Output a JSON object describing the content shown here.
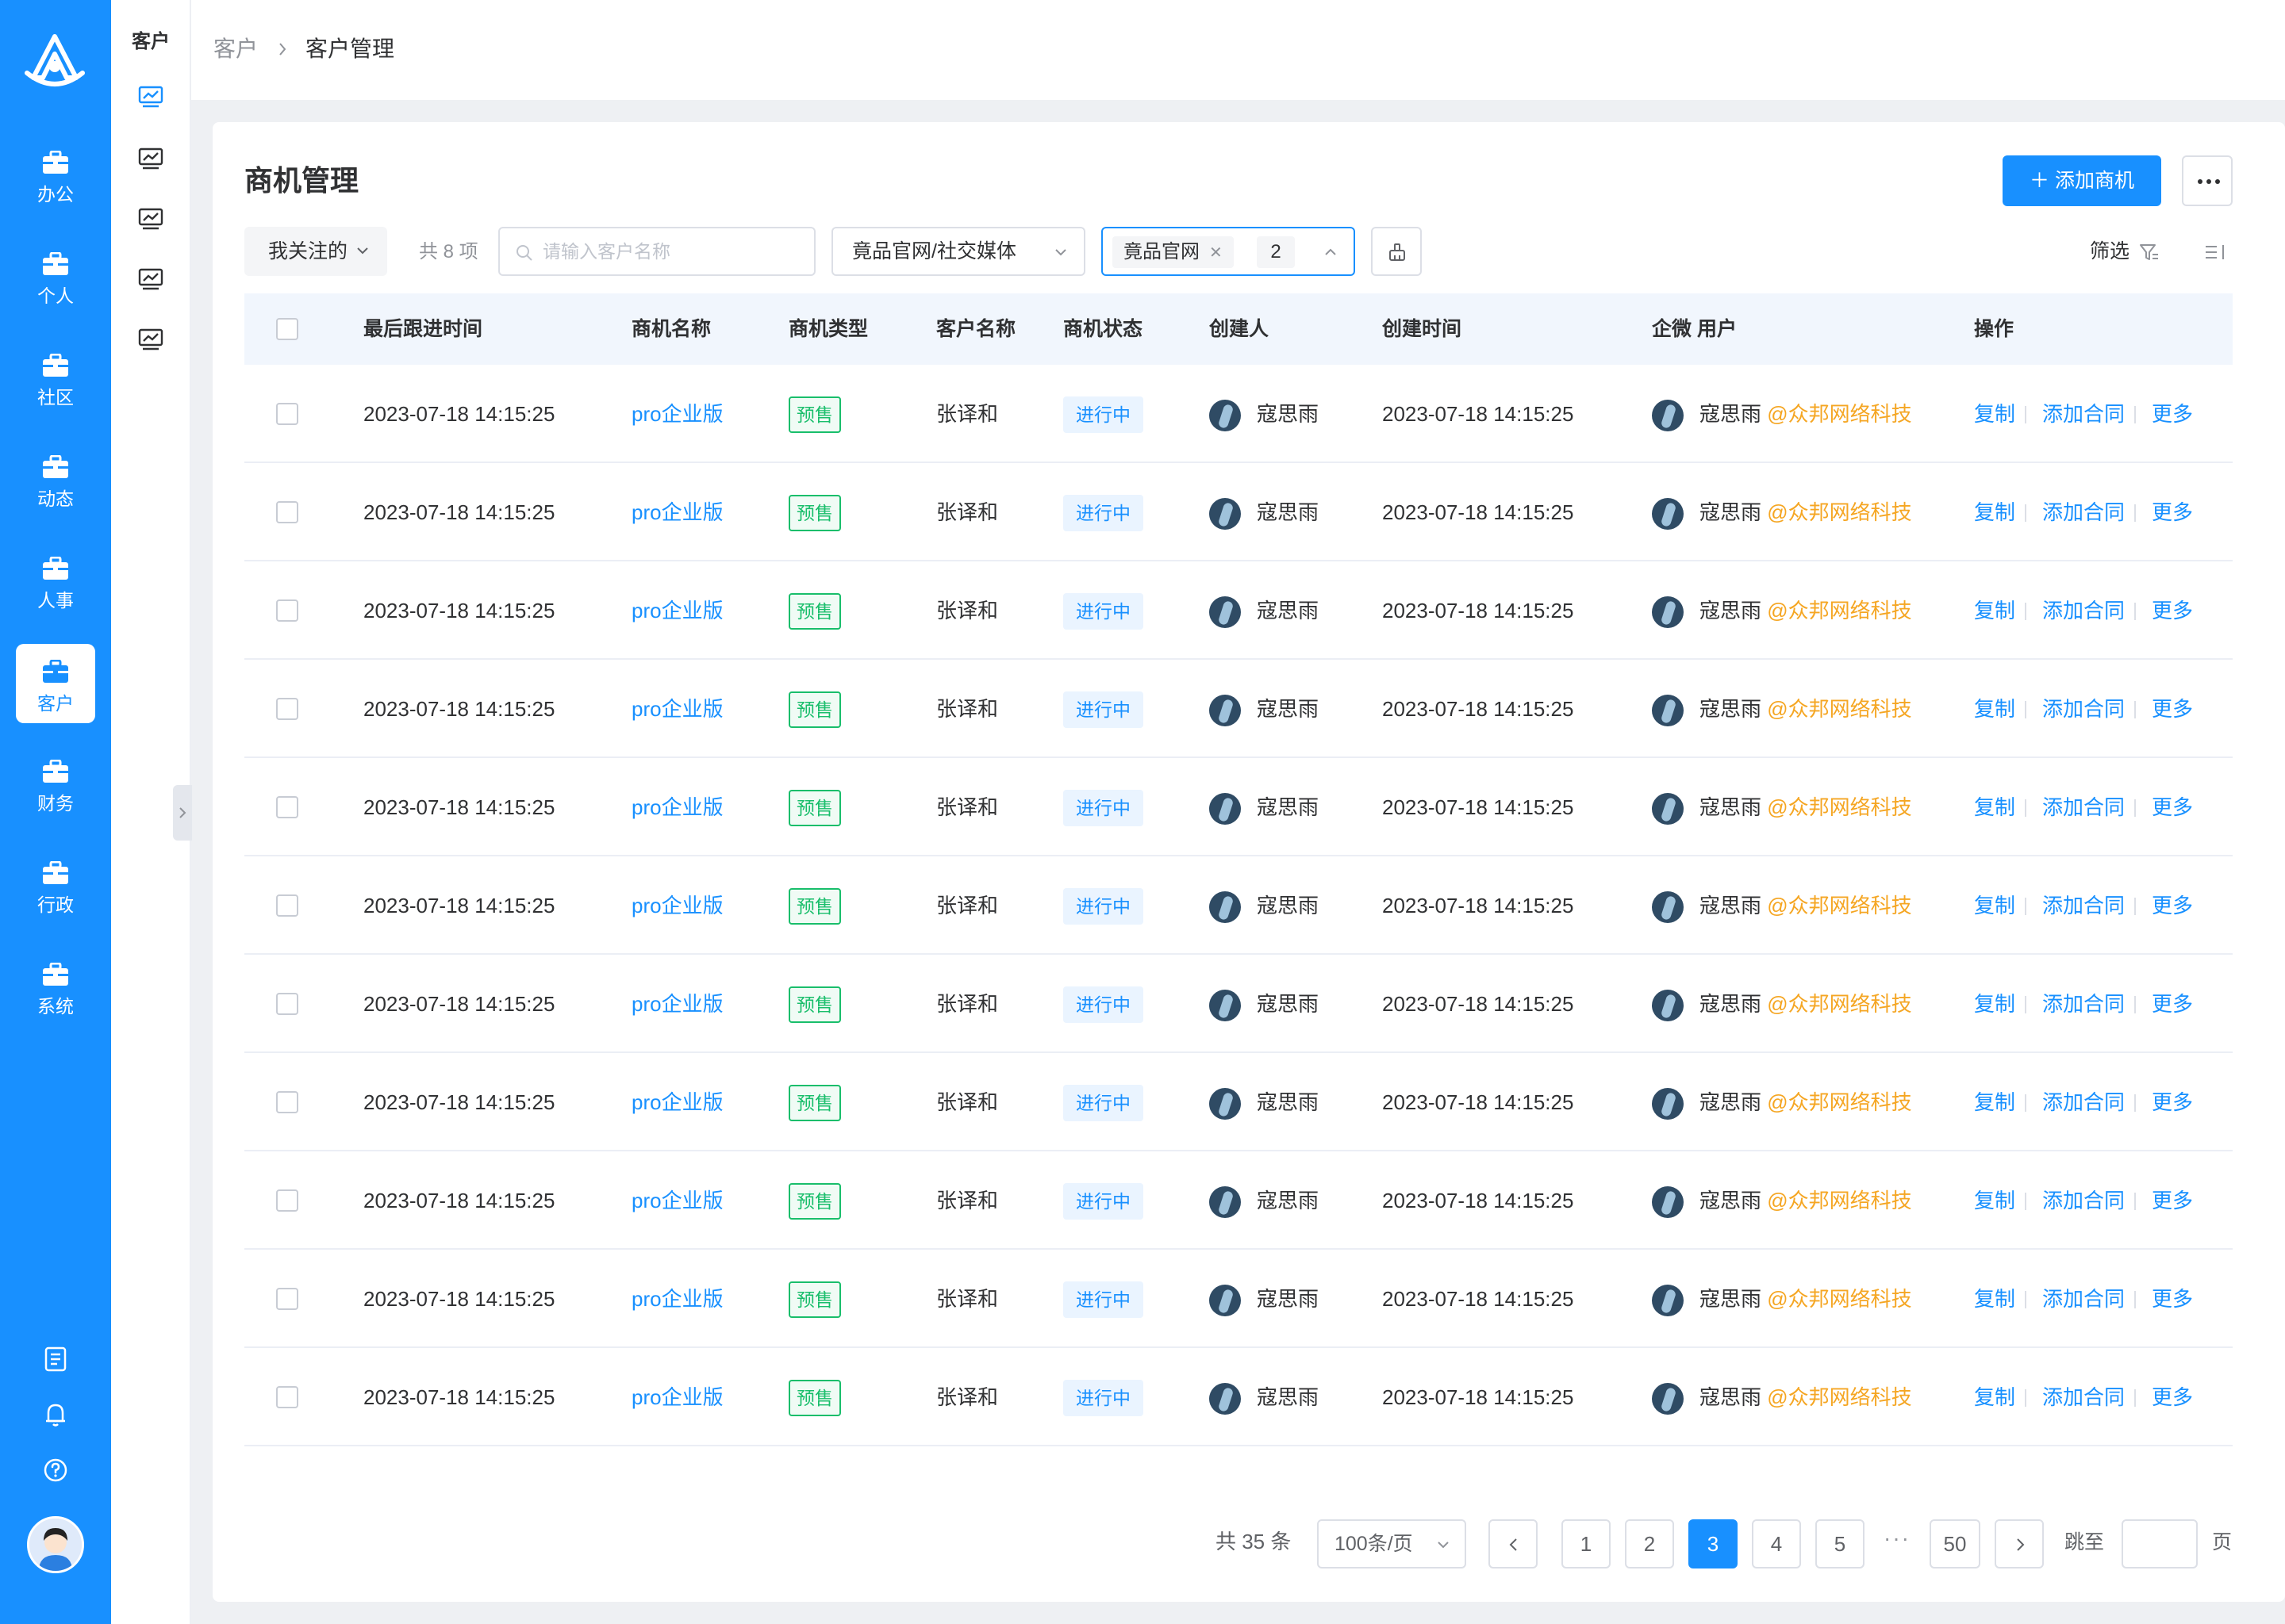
{
  "nav": {
    "items": [
      {
        "label": "办公",
        "icon": "briefcase-icon"
      },
      {
        "label": "个人",
        "icon": "briefcase-icon"
      },
      {
        "label": "社区",
        "icon": "briefcase-icon"
      },
      {
        "label": "动态",
        "icon": "briefcase-icon"
      },
      {
        "label": "人事",
        "icon": "briefcase-icon"
      },
      {
        "label": "客户",
        "icon": "briefcase-icon",
        "active": true
      },
      {
        "label": "财务",
        "icon": "briefcase-icon"
      },
      {
        "label": "行政",
        "icon": "briefcase-icon"
      },
      {
        "label": "系统",
        "icon": "briefcase-icon"
      }
    ],
    "bottom_icons": [
      "notes-icon",
      "bell-icon",
      "help-icon"
    ]
  },
  "submenu": {
    "title": "客户",
    "icons": [
      "chart-monitor-icon",
      "chart-monitor-icon",
      "chart-monitor-icon",
      "chart-monitor-icon",
      "chart-monitor-icon"
    ]
  },
  "breadcrumb": [
    "客户",
    "客户管理"
  ],
  "page": {
    "title": "商机管理",
    "add_button": "添加商机"
  },
  "filters": {
    "follow": "我关注的",
    "count": "共 8 项",
    "search_placeholder": "请输入客户名称",
    "media_select": "竟品官网/社交媒体",
    "tag_chip": "竟品官网",
    "tag_extra_count": "2",
    "screen_label": "筛选"
  },
  "table": {
    "columns": [
      "最后跟进时间",
      "商机名称",
      "商机类型",
      "客户名称",
      "商机状态",
      "创建人",
      "创建时间",
      "企微 用户",
      "操作"
    ],
    "rows": [
      {
        "last_follow": "2023-07-18 14:15:25",
        "name": "pro企业版",
        "type": "预售",
        "customer": "张译和",
        "status": "进行中",
        "creator": "寇思雨",
        "created": "2023-07-18 14:15:25",
        "wecom_user": "寇思雨",
        "company": "@众邦网络科技"
      },
      {
        "last_follow": "2023-07-18 14:15:25",
        "name": "pro企业版",
        "type": "预售",
        "customer": "张译和",
        "status": "进行中",
        "creator": "寇思雨",
        "created": "2023-07-18 14:15:25",
        "wecom_user": "寇思雨",
        "company": "@众邦网络科技"
      },
      {
        "last_follow": "2023-07-18 14:15:25",
        "name": "pro企业版",
        "type": "预售",
        "customer": "张译和",
        "status": "进行中",
        "creator": "寇思雨",
        "created": "2023-07-18 14:15:25",
        "wecom_user": "寇思雨",
        "company": "@众邦网络科技"
      },
      {
        "last_follow": "2023-07-18 14:15:25",
        "name": "pro企业版",
        "type": "预售",
        "customer": "张译和",
        "status": "进行中",
        "creator": "寇思雨",
        "created": "2023-07-18 14:15:25",
        "wecom_user": "寇思雨",
        "company": "@众邦网络科技"
      },
      {
        "last_follow": "2023-07-18 14:15:25",
        "name": "pro企业版",
        "type": "预售",
        "customer": "张译和",
        "status": "进行中",
        "creator": "寇思雨",
        "created": "2023-07-18 14:15:25",
        "wecom_user": "寇思雨",
        "company": "@众邦网络科技"
      },
      {
        "last_follow": "2023-07-18 14:15:25",
        "name": "pro企业版",
        "type": "预售",
        "customer": "张译和",
        "status": "进行中",
        "creator": "寇思雨",
        "created": "2023-07-18 14:15:25",
        "wecom_user": "寇思雨",
        "company": "@众邦网络科技"
      },
      {
        "last_follow": "2023-07-18 14:15:25",
        "name": "pro企业版",
        "type": "预售",
        "customer": "张译和",
        "status": "进行中",
        "creator": "寇思雨",
        "created": "2023-07-18 14:15:25",
        "wecom_user": "寇思雨",
        "company": "@众邦网络科技"
      },
      {
        "last_follow": "2023-07-18 14:15:25",
        "name": "pro企业版",
        "type": "预售",
        "customer": "张译和",
        "status": "进行中",
        "creator": "寇思雨",
        "created": "2023-07-18 14:15:25",
        "wecom_user": "寇思雨",
        "company": "@众邦网络科技"
      },
      {
        "last_follow": "2023-07-18 14:15:25",
        "name": "pro企业版",
        "type": "预售",
        "customer": "张译和",
        "status": "进行中",
        "creator": "寇思雨",
        "created": "2023-07-18 14:15:25",
        "wecom_user": "寇思雨",
        "company": "@众邦网络科技"
      },
      {
        "last_follow": "2023-07-18 14:15:25",
        "name": "pro企业版",
        "type": "预售",
        "customer": "张译和",
        "status": "进行中",
        "creator": "寇思雨",
        "created": "2023-07-18 14:15:25",
        "wecom_user": "寇思雨",
        "company": "@众邦网络科技"
      },
      {
        "last_follow": "2023-07-18 14:15:25",
        "name": "pro企业版",
        "type": "预售",
        "customer": "张译和",
        "status": "进行中",
        "creator": "寇思雨",
        "created": "2023-07-18 14:15:25",
        "wecom_user": "寇思雨",
        "company": "@众邦网络科技"
      }
    ],
    "actions": [
      "复制",
      "添加合同",
      "更多"
    ]
  },
  "pagination": {
    "total": "共 35 条",
    "page_size": "100条/页",
    "pages": [
      "1",
      "2",
      "3",
      "4",
      "5"
    ],
    "current": "3",
    "last": "50",
    "jump_label": "跳至",
    "page_label": "页"
  },
  "colors": {
    "primary": "#1890ff",
    "presale": "#19be6b",
    "company": "#f5a623"
  }
}
